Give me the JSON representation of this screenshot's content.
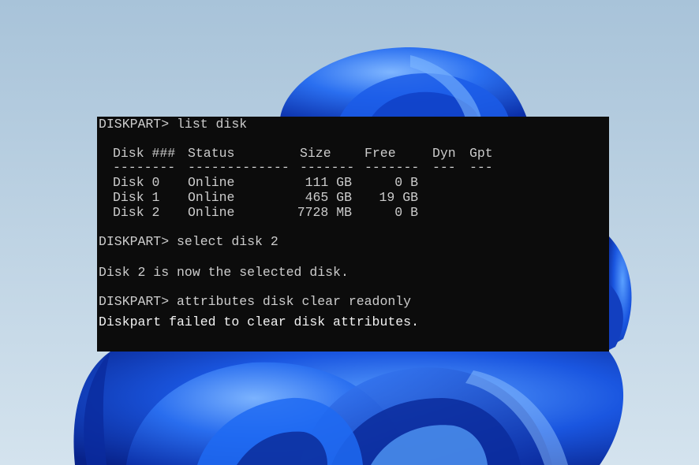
{
  "terminal": {
    "prompt1": "DISKPART> list disk",
    "headers": [
      "Disk ###",
      "Status",
      "Size",
      "Free",
      "Dyn",
      "Gpt"
    ],
    "separators": [
      "--------",
      "-------------",
      "-------",
      "-------",
      "---",
      "---"
    ],
    "rows": [
      {
        "disk": "Disk 0",
        "status": "Online",
        "size": "111 GB",
        "free": "0 B"
      },
      {
        "disk": "Disk 1",
        "status": "Online",
        "size": "465 GB",
        "free": "19 GB"
      },
      {
        "disk": "Disk 2",
        "status": "Online",
        "size": "7728 MB",
        "free": "0 B"
      }
    ],
    "prompt2": "DISKPART> select disk 2",
    "result2": "Disk 2 is now the selected disk.",
    "prompt3": "DISKPART> attributes disk clear readonly",
    "result3": "Diskpart failed to clear disk attributes."
  },
  "colors": {
    "terminal_bg": "#0c0c0c",
    "terminal_text": "#cccccc",
    "bloom_blue": "#1f5fe0"
  }
}
